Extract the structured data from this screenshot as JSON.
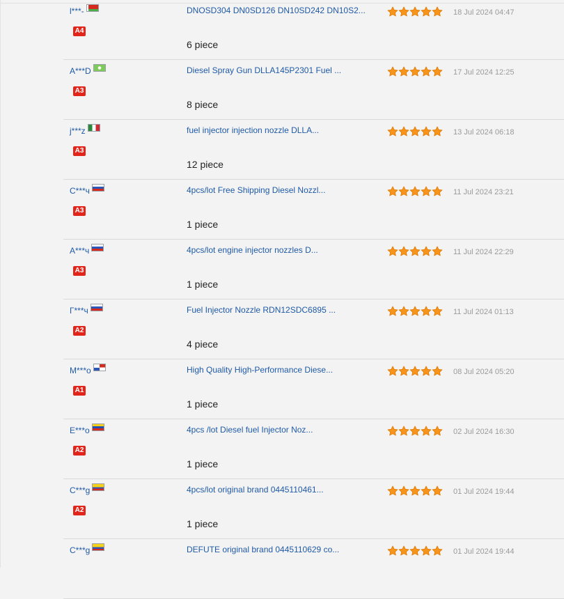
{
  "feedback": [
    {
      "buyer": "l***-",
      "flag": {
        "stripes": [
          "#d52b1e",
          "#d52b1e",
          "#4aae4a"
        ],
        "direction": "horizontal",
        "hoist": "#ffffff"
      },
      "level": "A4",
      "product": "DNOSD304 DN0SD126 DN10SD242 DN10S2...",
      "quantity": "6 piece",
      "rating": 5,
      "date": "18 Jul 2024 04:47"
    },
    {
      "buyer": "A***D",
      "flag": {
        "stripes": [
          "#7ecb5a",
          "#7ecb5a",
          "#7ecb5a"
        ],
        "direction": "horizontal",
        "emblem": "#ffffff"
      },
      "level": "A3",
      "product": "Diesel Spray Gun DLLA145P2301 Fuel ...",
      "quantity": "8 piece",
      "rating": 5,
      "date": "17 Jul 2024 12:25"
    },
    {
      "buyer": "j***z",
      "flag": {
        "stripes": [
          "#2a8a3c",
          "#ffffff",
          "#ce2b37"
        ],
        "direction": "vertical"
      },
      "level": "A3",
      "product": "fuel injector injection nozzle DLLA...",
      "quantity": "12 piece",
      "rating": 5,
      "date": "13 Jul 2024 06:18"
    },
    {
      "buyer": "C***ч",
      "flag": {
        "stripes": [
          "#ffffff",
          "#2c55b8",
          "#d52b1e"
        ],
        "direction": "horizontal"
      },
      "level": "A3",
      "product": "4pcs/lot Free Shipping Diesel Nozzl...",
      "quantity": "1 piece",
      "rating": 5,
      "date": "11 Jul 2024 23:21"
    },
    {
      "buyer": "А***ч",
      "flag": {
        "stripes": [
          "#ffffff",
          "#2c55b8",
          "#d52b1e"
        ],
        "direction": "horizontal"
      },
      "level": "A3",
      "product": "4pcs/lot engine injector nozzles D...",
      "quantity": "1 piece",
      "rating": 5,
      "date": "11 Jul 2024 22:29"
    },
    {
      "buyer": "Г***ч",
      "flag": {
        "stripes": [
          "#ffffff",
          "#2c55b8",
          "#d52b1e"
        ],
        "direction": "horizontal"
      },
      "level": "A2",
      "product": "Fuel Injector Nozzle RDN12SDC6895 ...",
      "quantity": "4 piece",
      "rating": 5,
      "date": "11 Jul 2024 01:13"
    },
    {
      "buyer": "M***o",
      "flag": {
        "stripes": [
          "#ffffff",
          "#2c55b8",
          "#d52b1e"
        ],
        "direction": "quarters"
      },
      "level": "A1",
      "product": "High Quality High-Performance Diese...",
      "quantity": "1 piece",
      "rating": 5,
      "date": "08 Jul 2024 05:20"
    },
    {
      "buyer": "E***o",
      "flag": {
        "stripes": [
          "#f7d117",
          "#1f4fb4",
          "#d52b1e"
        ],
        "direction": "horizontal"
      },
      "level": "A2",
      "product": "4pcs /lot Diesel fuel Injector Noz...",
      "quantity": "1 piece",
      "rating": 5,
      "date": "02 Jul 2024 16:30"
    },
    {
      "buyer": "C***g",
      "flag": {
        "stripes": [
          "#f7d117",
          "#f7d117",
          "#2c55b8"
        ],
        "direction": "horizontal",
        "bottom": "#d52b1e"
      },
      "level": "A2",
      "product": "4pcs/lot original brand 0445110461...",
      "quantity": "1 piece",
      "rating": 5,
      "date": "01 Jul 2024 19:44"
    },
    {
      "buyer": "C***g",
      "flag": {
        "stripes": [
          "#f7d117",
          "#f7d117",
          "#2c55b8"
        ],
        "direction": "horizontal",
        "bottom": "#d52b1e"
      },
      "level": "",
      "product": "DEFUTE original brand 0445110629 co...",
      "quantity": "",
      "rating": 5,
      "date": "01 Jul 2024 19:44"
    }
  ],
  "colors": {
    "link": "#1f5aa6",
    "star_fill": "#f7941d",
    "star_stroke": "#e07b00",
    "badge": "#e1251b",
    "date": "#9a9a9a"
  }
}
